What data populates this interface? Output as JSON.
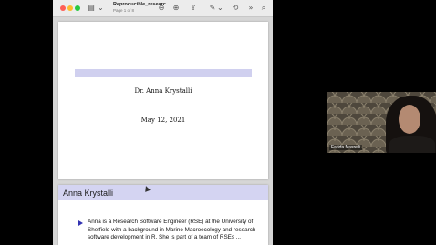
{
  "window": {
    "doc_title": "Reproducible_researc...",
    "doc_subtitle": "Page 1 of 8",
    "toolbar_icons": [
      "sidebar-icon",
      "zoom-out-icon",
      "zoom-in-icon",
      "share-icon",
      "markup-icon",
      "rotate-icon",
      "search-icon"
    ]
  },
  "slide1": {
    "author": "Dr. Anna Krystalli",
    "date": "May 12, 2021"
  },
  "slide2": {
    "frame_title": "Anna Krystalli",
    "bullet": "Anna is a Research Software Engineer (RSE) at the University of Sheffield with a background in Marine Macroecology and research software development in R. She is part of a team of RSEs ..."
  },
  "video": {
    "participant_name": "Farida Nasrelli"
  },
  "colors": {
    "frame_band": "#d0d0ef",
    "bullet": "#3333b2",
    "background": "#000000"
  }
}
